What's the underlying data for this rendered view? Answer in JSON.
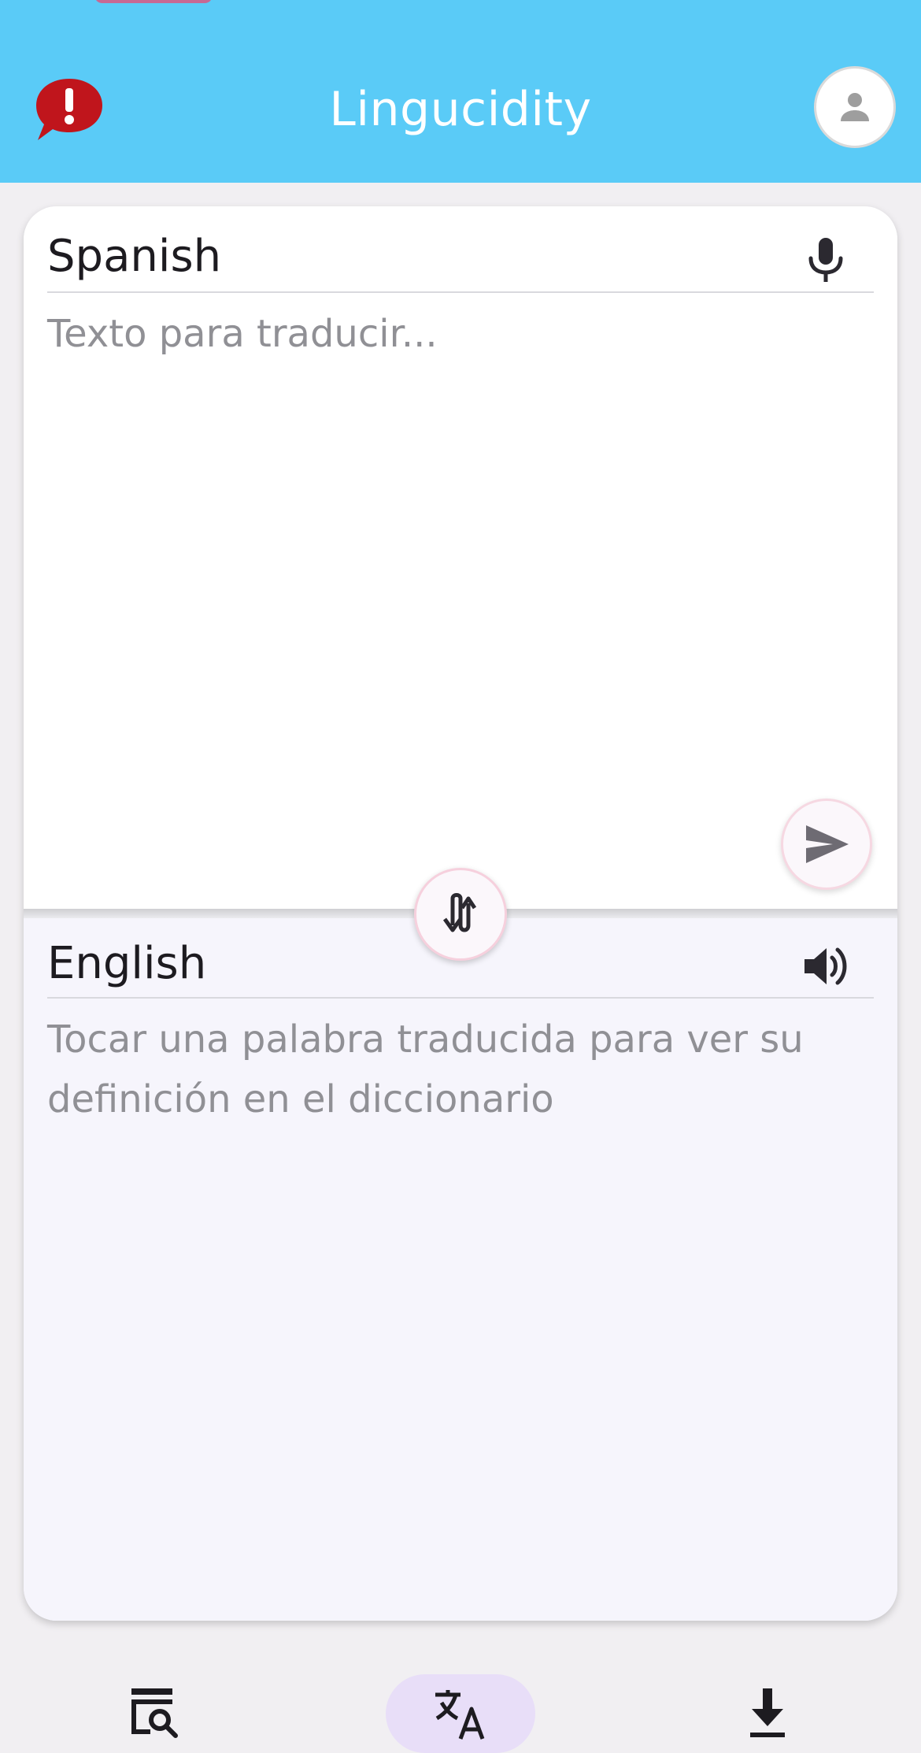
{
  "app_bar": {
    "title": "Lingucidity",
    "alert_icon": "alert-speech-bubble-icon",
    "profile_icon": "person-icon"
  },
  "source": {
    "language": "Spanish",
    "placeholder": "Texto para traducir...",
    "mic_icon": "microphone-icon",
    "send_icon": "send-icon"
  },
  "swap": {
    "icon": "swap-languages-icon"
  },
  "target": {
    "language": "English",
    "hint": "Tocar una palabra traducida para ver su definición en el diccionario",
    "speaker_icon": "speaker-icon"
  },
  "bottom_nav": {
    "items": [
      {
        "icon": "dictionary-search-icon",
        "active": false
      },
      {
        "icon": "translate-icon",
        "active": true
      },
      {
        "icon": "download-icon",
        "active": false
      }
    ]
  },
  "colors": {
    "app_bar": "#5acbf7",
    "alert": "#c0151c",
    "nav_active_pill": "#e8def8",
    "source_bg": "#ffffff",
    "target_bg": "#f6f5fc"
  }
}
